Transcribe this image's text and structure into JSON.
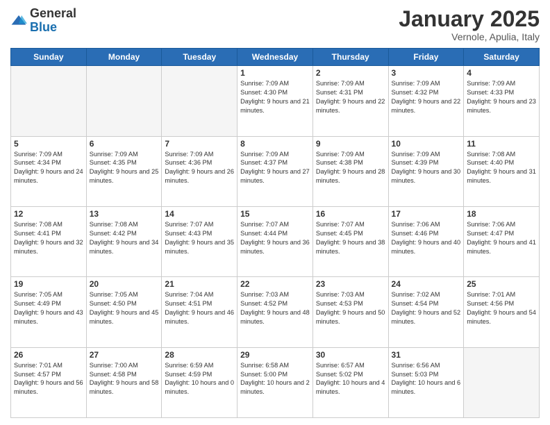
{
  "header": {
    "logo_general": "General",
    "logo_blue": "Blue",
    "month_title": "January 2025",
    "subtitle": "Vernole, Apulia, Italy"
  },
  "days_of_week": [
    "Sunday",
    "Monday",
    "Tuesday",
    "Wednesday",
    "Thursday",
    "Friday",
    "Saturday"
  ],
  "weeks": [
    [
      {
        "day": "",
        "empty": true
      },
      {
        "day": "",
        "empty": true
      },
      {
        "day": "",
        "empty": true
      },
      {
        "day": "1",
        "sunrise": "7:09 AM",
        "sunset": "4:30 PM",
        "daylight": "9 hours and 21 minutes."
      },
      {
        "day": "2",
        "sunrise": "7:09 AM",
        "sunset": "4:31 PM",
        "daylight": "9 hours and 22 minutes."
      },
      {
        "day": "3",
        "sunrise": "7:09 AM",
        "sunset": "4:32 PM",
        "daylight": "9 hours and 22 minutes."
      },
      {
        "day": "4",
        "sunrise": "7:09 AM",
        "sunset": "4:33 PM",
        "daylight": "9 hours and 23 minutes."
      }
    ],
    [
      {
        "day": "5",
        "sunrise": "7:09 AM",
        "sunset": "4:34 PM",
        "daylight": "9 hours and 24 minutes."
      },
      {
        "day": "6",
        "sunrise": "7:09 AM",
        "sunset": "4:35 PM",
        "daylight": "9 hours and 25 minutes."
      },
      {
        "day": "7",
        "sunrise": "7:09 AM",
        "sunset": "4:36 PM",
        "daylight": "9 hours and 26 minutes."
      },
      {
        "day": "8",
        "sunrise": "7:09 AM",
        "sunset": "4:37 PM",
        "daylight": "9 hours and 27 minutes."
      },
      {
        "day": "9",
        "sunrise": "7:09 AM",
        "sunset": "4:38 PM",
        "daylight": "9 hours and 28 minutes."
      },
      {
        "day": "10",
        "sunrise": "7:09 AM",
        "sunset": "4:39 PM",
        "daylight": "9 hours and 30 minutes."
      },
      {
        "day": "11",
        "sunrise": "7:08 AM",
        "sunset": "4:40 PM",
        "daylight": "9 hours and 31 minutes."
      }
    ],
    [
      {
        "day": "12",
        "sunrise": "7:08 AM",
        "sunset": "4:41 PM",
        "daylight": "9 hours and 32 minutes."
      },
      {
        "day": "13",
        "sunrise": "7:08 AM",
        "sunset": "4:42 PM",
        "daylight": "9 hours and 34 minutes."
      },
      {
        "day": "14",
        "sunrise": "7:07 AM",
        "sunset": "4:43 PM",
        "daylight": "9 hours and 35 minutes."
      },
      {
        "day": "15",
        "sunrise": "7:07 AM",
        "sunset": "4:44 PM",
        "daylight": "9 hours and 36 minutes."
      },
      {
        "day": "16",
        "sunrise": "7:07 AM",
        "sunset": "4:45 PM",
        "daylight": "9 hours and 38 minutes."
      },
      {
        "day": "17",
        "sunrise": "7:06 AM",
        "sunset": "4:46 PM",
        "daylight": "9 hours and 40 minutes."
      },
      {
        "day": "18",
        "sunrise": "7:06 AM",
        "sunset": "4:47 PM",
        "daylight": "9 hours and 41 minutes."
      }
    ],
    [
      {
        "day": "19",
        "sunrise": "7:05 AM",
        "sunset": "4:49 PM",
        "daylight": "9 hours and 43 minutes."
      },
      {
        "day": "20",
        "sunrise": "7:05 AM",
        "sunset": "4:50 PM",
        "daylight": "9 hours and 45 minutes."
      },
      {
        "day": "21",
        "sunrise": "7:04 AM",
        "sunset": "4:51 PM",
        "daylight": "9 hours and 46 minutes."
      },
      {
        "day": "22",
        "sunrise": "7:03 AM",
        "sunset": "4:52 PM",
        "daylight": "9 hours and 48 minutes."
      },
      {
        "day": "23",
        "sunrise": "7:03 AM",
        "sunset": "4:53 PM",
        "daylight": "9 hours and 50 minutes."
      },
      {
        "day": "24",
        "sunrise": "7:02 AM",
        "sunset": "4:54 PM",
        "daylight": "9 hours and 52 minutes."
      },
      {
        "day": "25",
        "sunrise": "7:01 AM",
        "sunset": "4:56 PM",
        "daylight": "9 hours and 54 minutes."
      }
    ],
    [
      {
        "day": "26",
        "sunrise": "7:01 AM",
        "sunset": "4:57 PM",
        "daylight": "9 hours and 56 minutes."
      },
      {
        "day": "27",
        "sunrise": "7:00 AM",
        "sunset": "4:58 PM",
        "daylight": "9 hours and 58 minutes."
      },
      {
        "day": "28",
        "sunrise": "6:59 AM",
        "sunset": "4:59 PM",
        "daylight": "10 hours and 0 minutes."
      },
      {
        "day": "29",
        "sunrise": "6:58 AM",
        "sunset": "5:00 PM",
        "daylight": "10 hours and 2 minutes."
      },
      {
        "day": "30",
        "sunrise": "6:57 AM",
        "sunset": "5:02 PM",
        "daylight": "10 hours and 4 minutes."
      },
      {
        "day": "31",
        "sunrise": "6:56 AM",
        "sunset": "5:03 PM",
        "daylight": "10 hours and 6 minutes."
      },
      {
        "day": "",
        "empty": true
      }
    ]
  ]
}
